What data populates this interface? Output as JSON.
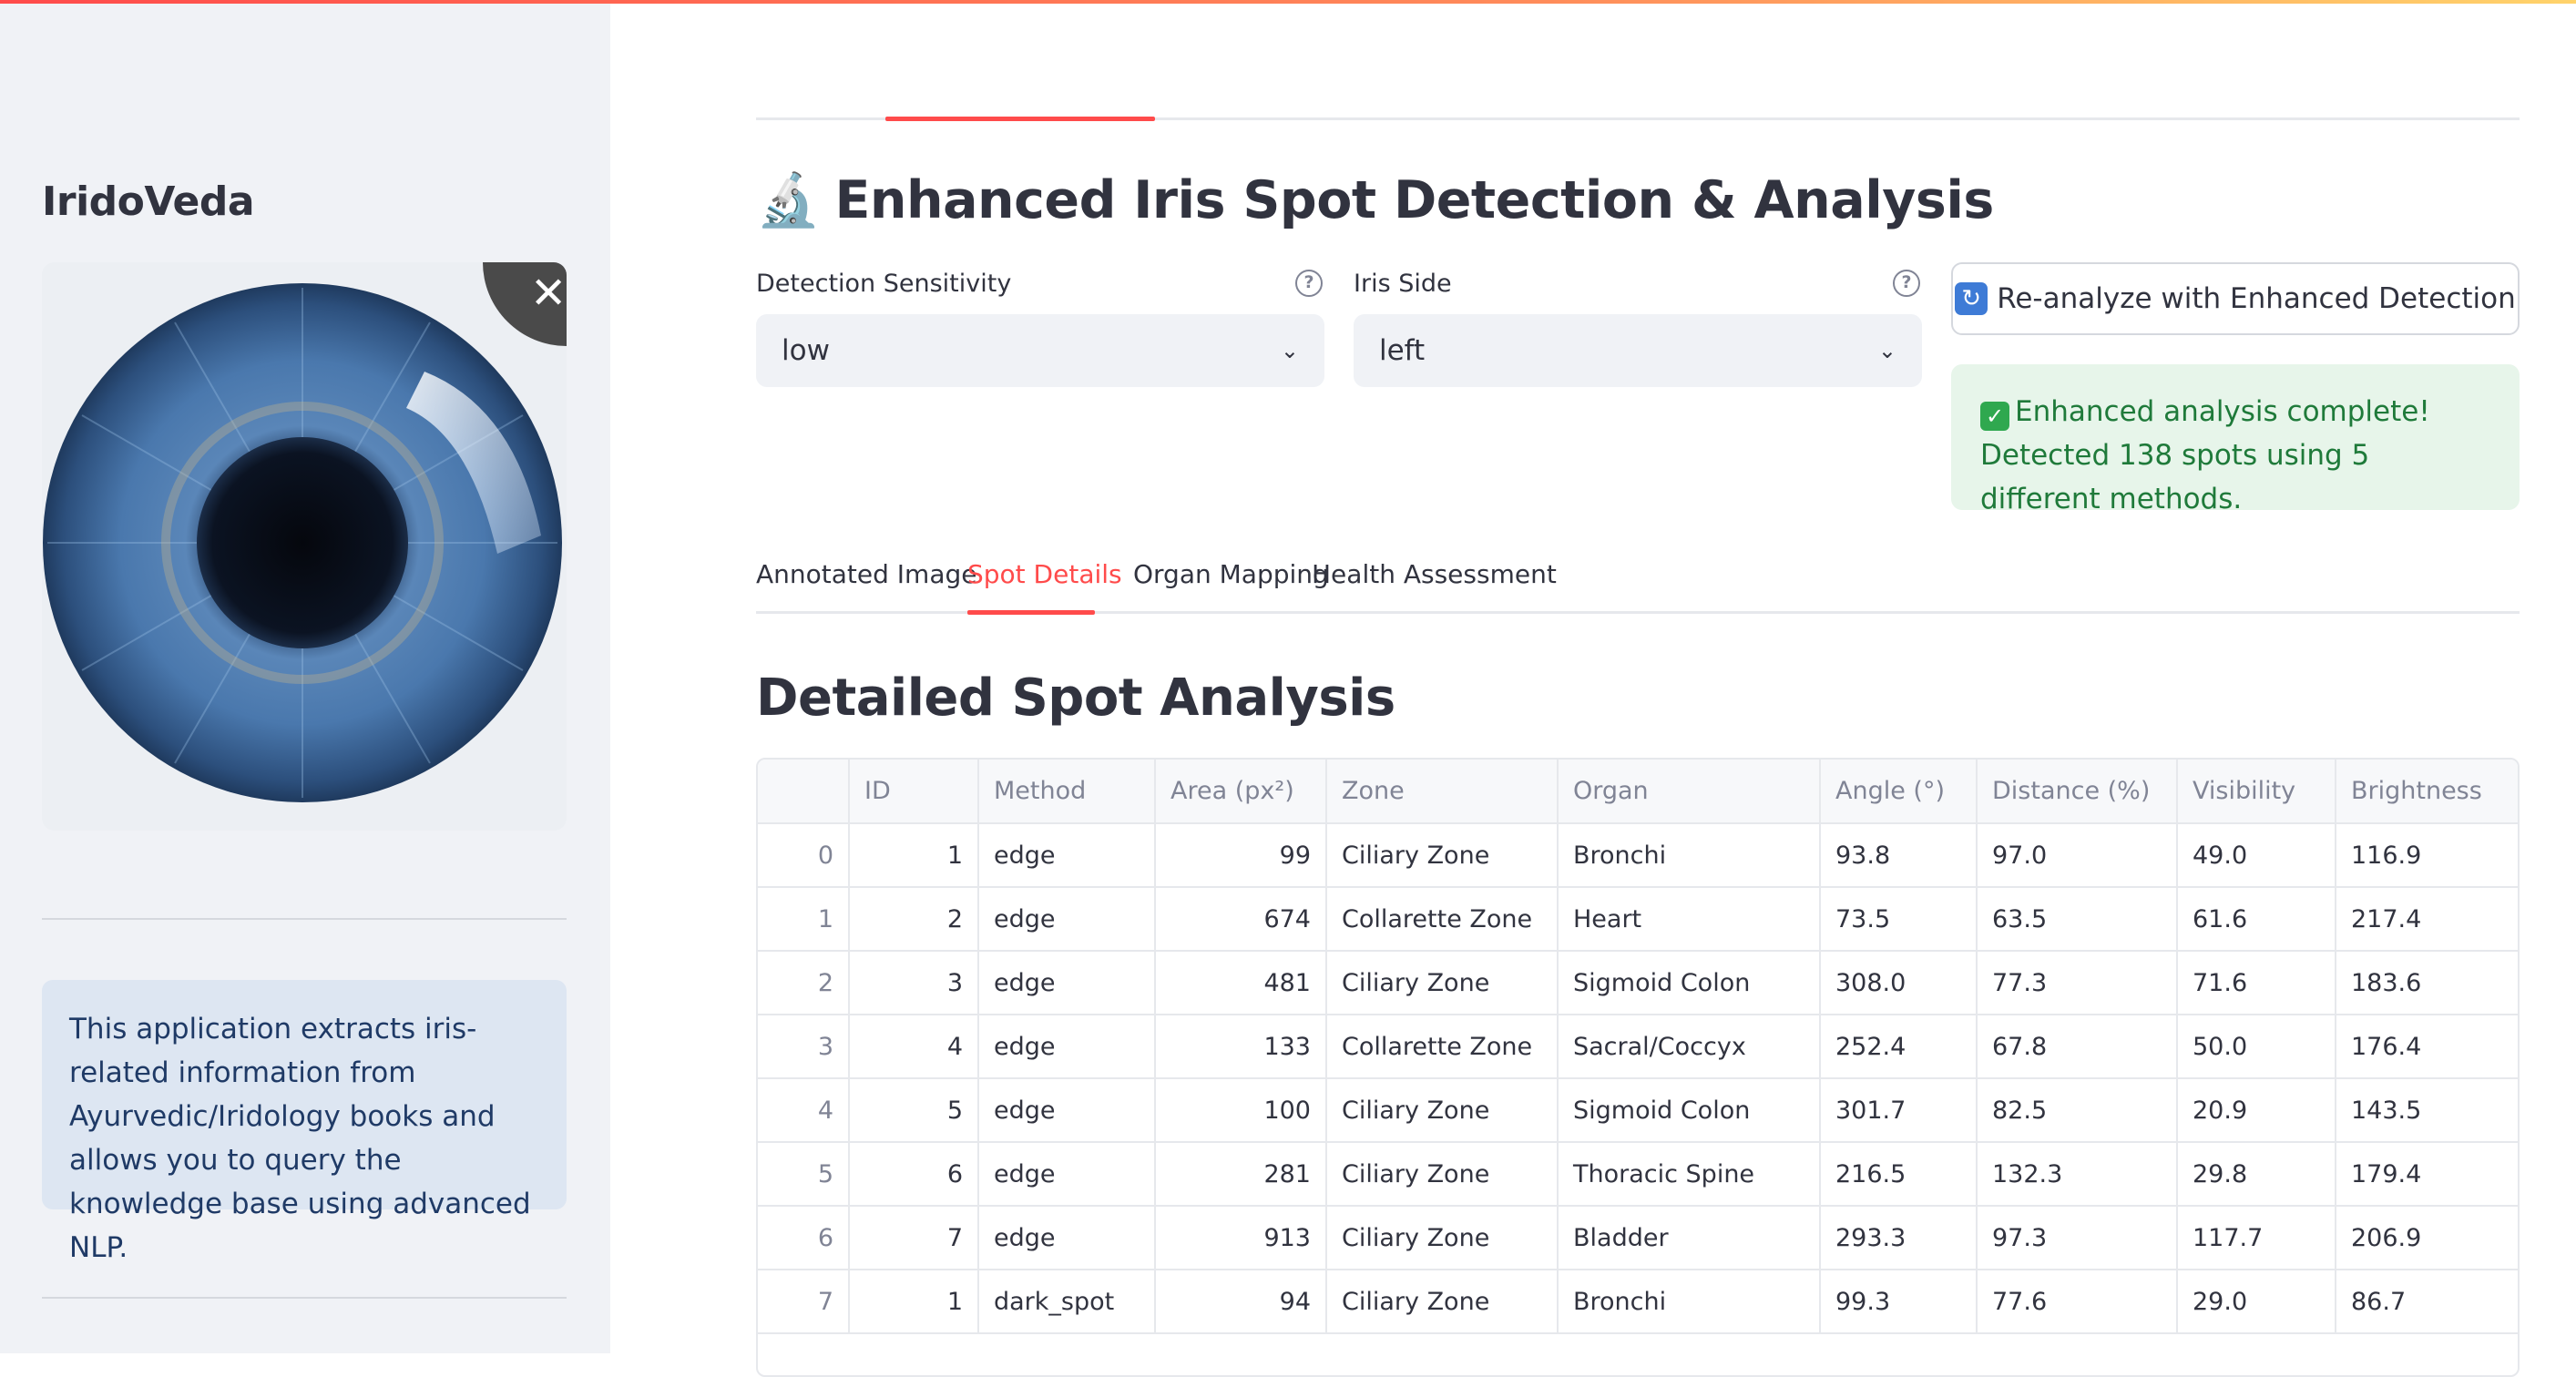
{
  "sidebar": {
    "brand": "IridoVeda",
    "info": "This application extracts iris-related information from Ayurvedic/Iridology books and allows you to query the knowledge base using advanced NLP."
  },
  "main": {
    "title_icon": "🔬",
    "title": "Enhanced Iris Spot Detection & Analysis",
    "sensitivity": {
      "label": "Detection Sensitivity",
      "value": "low"
    },
    "iris_side": {
      "label": "Iris Side",
      "value": "left"
    },
    "reanalyze_button": "Re-analyze with Enhanced Detection",
    "success_message": "Enhanced analysis complete! Detected 138 spots using 5 different methods.",
    "tabs": [
      "Annotated Image",
      "Spot Details",
      "Organ Mapping",
      "Health Assessment"
    ],
    "active_tab": "Spot Details",
    "section_title": "Detailed Spot Analysis",
    "table": {
      "columns": [
        "",
        "ID",
        "Method",
        "Area (px²)",
        "Zone",
        "Organ",
        "Angle (°)",
        "Distance (%)",
        "Visibility",
        "Brightness"
      ],
      "rows": [
        [
          "0",
          "1",
          "edge",
          "99",
          "Ciliary Zone",
          "Bronchi",
          "93.8",
          "97.0",
          "49.0",
          "116.9"
        ],
        [
          "1",
          "2",
          "edge",
          "674",
          "Collarette Zone",
          "Heart",
          "73.5",
          "63.5",
          "61.6",
          "217.4"
        ],
        [
          "2",
          "3",
          "edge",
          "481",
          "Ciliary Zone",
          "Sigmoid Colon",
          "308.0",
          "77.3",
          "71.6",
          "183.6"
        ],
        [
          "3",
          "4",
          "edge",
          "133",
          "Collarette Zone",
          "Sacral/Coccyx",
          "252.4",
          "67.8",
          "50.0",
          "176.4"
        ],
        [
          "4",
          "5",
          "edge",
          "100",
          "Ciliary Zone",
          "Sigmoid Colon",
          "301.7",
          "82.5",
          "20.9",
          "143.5"
        ],
        [
          "5",
          "6",
          "edge",
          "281",
          "Ciliary Zone",
          "Thoracic Spine",
          "216.5",
          "132.3",
          "29.8",
          "179.4"
        ],
        [
          "6",
          "7",
          "edge",
          "913",
          "Ciliary Zone",
          "Bladder",
          "293.3",
          "97.3",
          "117.7",
          "206.9"
        ],
        [
          "7",
          "1",
          "dark_spot",
          "94",
          "Ciliary Zone",
          "Bronchi",
          "99.3",
          "77.6",
          "29.0",
          "86.7"
        ]
      ]
    }
  },
  "icons": {
    "title": "microscope-icon",
    "reanalyze": "refresh-icon",
    "success": "check-icon",
    "select": "chevron-down-icon",
    "help": "help-icon",
    "close": "close-icon"
  },
  "colors": {
    "accent": "#ff4b4b",
    "sidebar_bg": "#f0f2f6",
    "info_bg": "#dde6f2",
    "success_bg": "#e7f5ea",
    "success_text": "#1f7a3a"
  }
}
